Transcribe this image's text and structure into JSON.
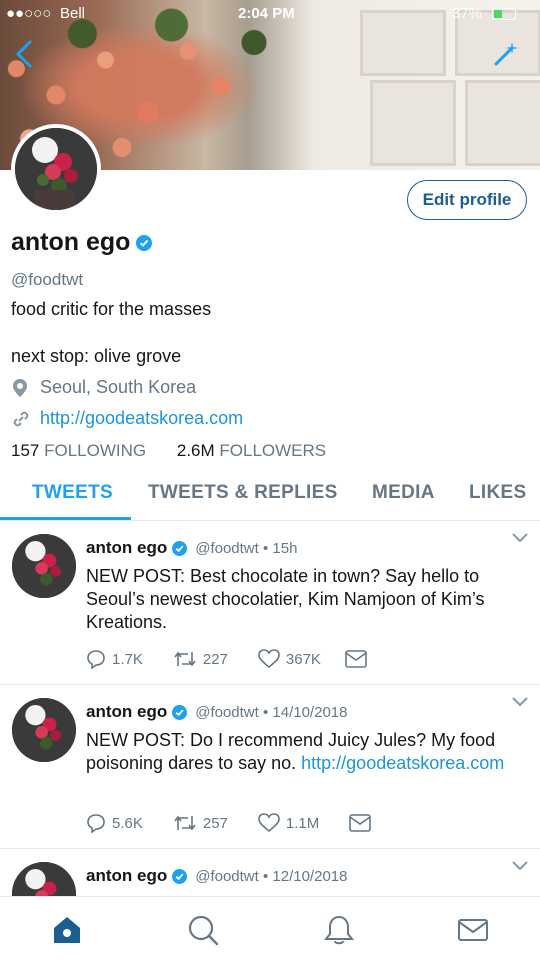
{
  "status": {
    "carrier": "Bell",
    "time": "2:04 PM",
    "battery": "37%"
  },
  "profile": {
    "name": "anton ego",
    "handle": "@foodtwt",
    "bio1": "food critic for the masses",
    "bio2": "next stop: olive grove",
    "location": "Seoul, South Korea",
    "url": "http://goodeatskorea.com",
    "following_count": "157",
    "following_label": "FOLLOWING",
    "followers_count": "2.6M",
    "followers_label": "FOLLOWERS",
    "edit_label": "Edit profile"
  },
  "tabs": [
    {
      "label": "TWEETS"
    },
    {
      "label": "TWEETS & REPLIES"
    },
    {
      "label": "MEDIA"
    },
    {
      "label": "LIKES"
    }
  ],
  "tweets": [
    {
      "name": "anton ego",
      "meta": "@foodtwt • 15h",
      "text": "NEW POST: Best chocolate in town? Say hello to Seoul’s newest chocolatier, Kim Namjoon of Kim’s Kreations.",
      "link": "",
      "replies": "1.7K",
      "retweets": "227",
      "likes": "367K"
    },
    {
      "name": "anton ego",
      "meta": "@foodtwt • 14/10/2018",
      "text": "NEW POST: Do I recommend Juicy Jules? My food poisoning dares to say no. ",
      "link": "http://goodeatskorea.com",
      "replies": "5.6K",
      "retweets": "257",
      "likes": "1.1M"
    },
    {
      "name": "anton ego",
      "meta": "@foodtwt • 12/10/2018"
    }
  ],
  "colors": {
    "accent": "#1da1f2",
    "link": "#1b95e0",
    "muted": "#657786",
    "edit_border": "#1b5e92"
  },
  "icons": [
    "back-icon",
    "sparkle-icon",
    "verified-icon",
    "location-pin-icon",
    "link-icon",
    "reply-icon",
    "retweet-icon",
    "like-icon",
    "message-icon",
    "home-icon",
    "search-icon",
    "notifications-icon",
    "messages-icon",
    "caret-down-icon"
  ]
}
